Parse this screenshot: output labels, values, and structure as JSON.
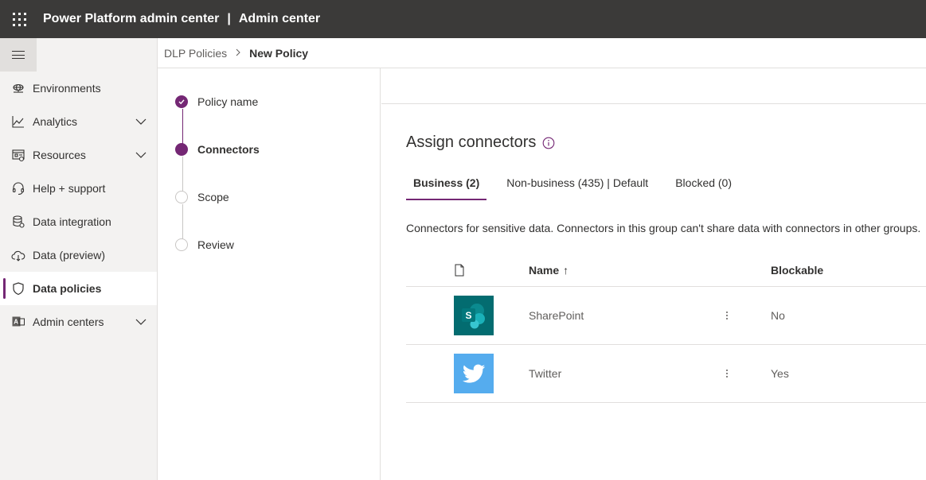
{
  "header": {
    "app_title": "Power Platform admin center",
    "separator": "|",
    "section_title": "Admin center"
  },
  "sidebar": {
    "items": [
      {
        "label": "Environments",
        "icon": "globe-icon",
        "chevron": false,
        "active": false
      },
      {
        "label": "Analytics",
        "icon": "chart-line-icon",
        "chevron": true,
        "active": false
      },
      {
        "label": "Resources",
        "icon": "resources-icon",
        "chevron": true,
        "active": false
      },
      {
        "label": "Help + support",
        "icon": "headset-icon",
        "chevron": false,
        "active": false
      },
      {
        "label": "Data integration",
        "icon": "database-icon",
        "chevron": false,
        "active": false
      },
      {
        "label": "Data (preview)",
        "icon": "cloud-icon",
        "chevron": false,
        "active": false
      },
      {
        "label": "Data policies",
        "icon": "shield-icon",
        "chevron": false,
        "active": true
      },
      {
        "label": "Admin centers",
        "icon": "admin-centers-icon",
        "chevron": true,
        "active": false
      }
    ]
  },
  "breadcrumb": {
    "parent": "DLP Policies",
    "separator": ">",
    "current": "New Policy"
  },
  "wizard": {
    "steps": [
      {
        "label": "Policy name",
        "state": "done"
      },
      {
        "label": "Connectors",
        "state": "current"
      },
      {
        "label": "Scope",
        "state": "todo"
      },
      {
        "label": "Review",
        "state": "todo"
      }
    ]
  },
  "main": {
    "title": "Assign connectors",
    "tabs": [
      {
        "label": "Business (2)",
        "active": true
      },
      {
        "label": "Non-business (435) | Default",
        "active": false
      },
      {
        "label": "Blocked (0)",
        "active": false
      }
    ],
    "description": "Connectors for sensitive data. Connectors in this group can't share data with connectors in other groups.",
    "table": {
      "headers": {
        "icon": "file-icon",
        "name": "Name",
        "sort_indicator": "↑",
        "blockable": "Blockable"
      },
      "rows": [
        {
          "name": "SharePoint",
          "blockable": "No",
          "logo": "sharepoint-logo",
          "logo_letter": "S",
          "logo_color": "#036c70"
        },
        {
          "name": "Twitter",
          "blockable": "Yes",
          "logo": "twitter-logo",
          "logo_color": "#55acee"
        }
      ]
    }
  },
  "colors": {
    "accent": "#742774",
    "topbar": "#3b3a39",
    "sidebar": "#f3f2f1"
  }
}
